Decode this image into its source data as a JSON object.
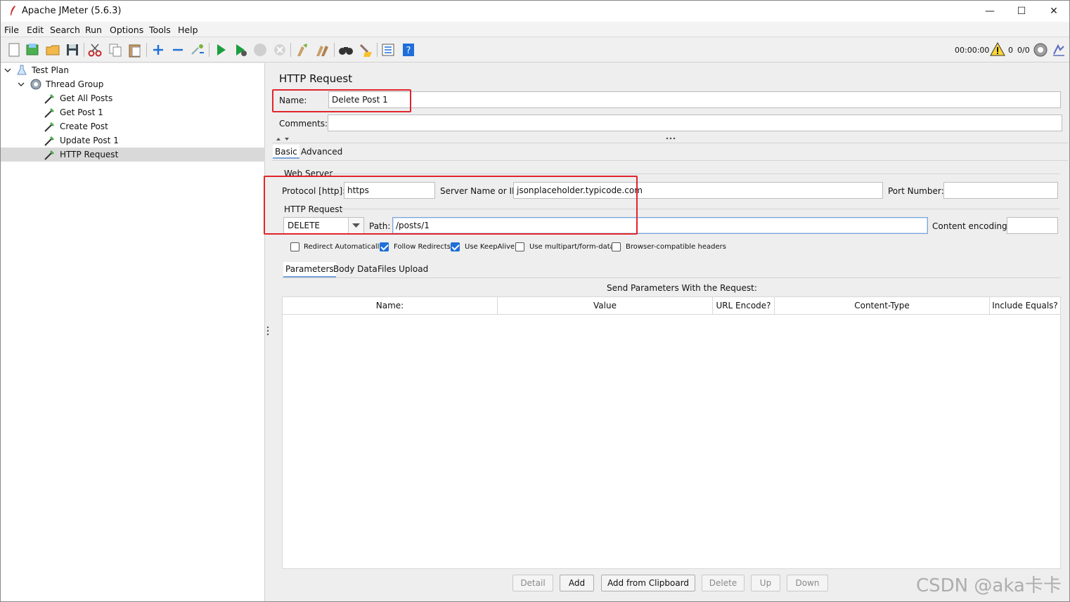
{
  "window": {
    "title": "Apache JMeter (5.6.3)",
    "controls": {
      "minimize": "—",
      "maximize": "☐",
      "close": "✕"
    }
  },
  "menu": [
    {
      "label": "File"
    },
    {
      "label": "Edit"
    },
    {
      "label": "Search"
    },
    {
      "label": "Run"
    },
    {
      "label": "Options"
    },
    {
      "label": "Tools"
    },
    {
      "label": "Help"
    }
  ],
  "toolbar": {
    "icons": [
      "new-icon",
      "templates-icon",
      "open-icon",
      "save-icon",
      "cut-icon",
      "copy-icon",
      "paste-icon",
      "expand-icon",
      "collapse-icon",
      "toggle-icon",
      "start-icon",
      "start-no-pause-icon",
      "stop-icon",
      "shutdown-icon",
      "clear-icon",
      "clear-all-icon",
      "search-icon",
      "reset-search-icon",
      "function-helper-icon",
      "help-icon"
    ],
    "status": {
      "timer": "00:00:00",
      "warnings": "0",
      "threads": "0/0"
    }
  },
  "tree": {
    "items": [
      {
        "label": "Test Plan",
        "level": 0,
        "expanded": true,
        "icon": "flask-icon"
      },
      {
        "label": "Thread Group",
        "level": 1,
        "expanded": true,
        "icon": "gear-icon"
      },
      {
        "label": "Get All Posts",
        "level": 2,
        "icon": "sampler-pipette-icon"
      },
      {
        "label": "Get Post 1",
        "level": 2,
        "icon": "sampler-pipette-icon"
      },
      {
        "label": "Create Post",
        "level": 2,
        "icon": "sampler-pipette-icon"
      },
      {
        "label": "Update Post 1",
        "level": 2,
        "icon": "sampler-pipette-icon"
      },
      {
        "label": "HTTP Request",
        "level": 2,
        "icon": "sampler-pipette-icon",
        "selected": true
      }
    ]
  },
  "panel": {
    "title": "HTTP Request",
    "name_label": "Name:",
    "name_value": "Delete Post 1",
    "comments_label": "Comments:",
    "comments_value": "",
    "tabs": [
      {
        "label": "Basic",
        "active": true
      },
      {
        "label": "Advanced"
      }
    ],
    "web_server": {
      "section_label": "Web Server",
      "protocol_label": "Protocol [http]:",
      "protocol_value": "https",
      "server_label": "Server Name or IP:",
      "server_value": "jsonplaceholder.typicode.com",
      "port_label": "Port Number:",
      "port_value": ""
    },
    "http_request": {
      "section_label": "HTTP Request",
      "method": "DELETE",
      "path_label": "Path:",
      "path_value": "/posts/1",
      "encoding_label": "Content encoding:",
      "encoding_value": ""
    },
    "checkboxes": [
      {
        "label": "Redirect Automatically",
        "checked": false
      },
      {
        "label": "Follow Redirects",
        "checked": true
      },
      {
        "label": "Use KeepAlive",
        "checked": true
      },
      {
        "label": "Use multipart/form-data",
        "checked": false
      },
      {
        "label": "Browser-compatible headers",
        "checked": false
      }
    ],
    "sub_tabs": [
      {
        "label": "Parameters",
        "active": true
      },
      {
        "label": "Body Data"
      },
      {
        "label": "Files Upload"
      }
    ],
    "params_caption": "Send Parameters With the Request:",
    "columns": [
      "Name:",
      "Value",
      "URL Encode?",
      "Content-Type",
      "Include Equals?"
    ],
    "rows": [],
    "buttons": [
      {
        "label": "Detail",
        "enabled": false
      },
      {
        "label": "Add",
        "enabled": true
      },
      {
        "label": "Add from Clipboard",
        "enabled": true
      },
      {
        "label": "Delete",
        "enabled": false
      },
      {
        "label": "Up",
        "enabled": false
      },
      {
        "label": "Down",
        "enabled": false
      }
    ]
  },
  "watermark": "CSDN @aka卡卡",
  "colors": {
    "highlight": "#e0252c",
    "selection": "#d9d9d9",
    "checkbox": "#1e6fd9",
    "focus": "#7aa3d9"
  }
}
